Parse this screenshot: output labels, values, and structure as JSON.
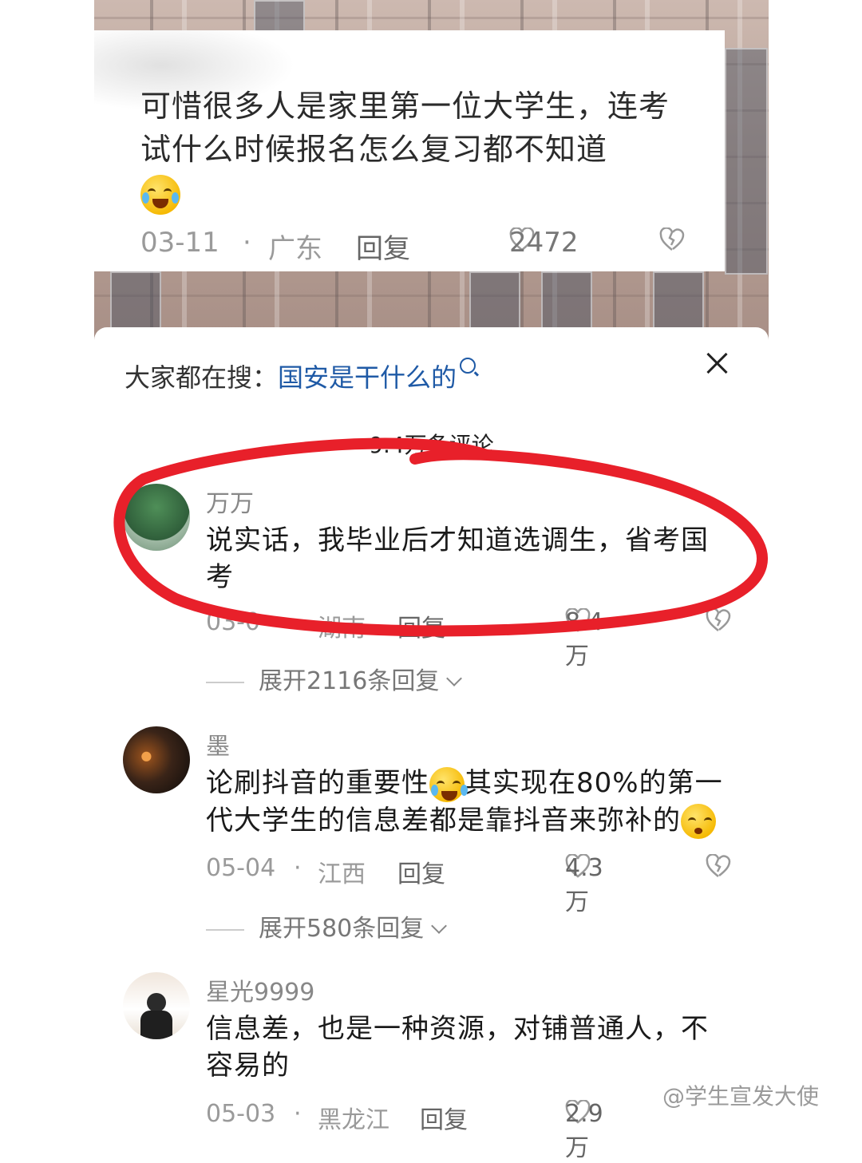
{
  "quote": {
    "text": "可惜很多人是家里第一位大学生，连考试什么时候报名怎么复习都不知道",
    "date": "03-11",
    "dot": "·",
    "location": "广东",
    "reply_label": "回复",
    "likes": "2472"
  },
  "search": {
    "prefix": "大家都在搜：",
    "query": "国安是干什么的"
  },
  "comment_count": "9.4万条评论",
  "comments": [
    {
      "user": "万万",
      "text": "说实话，我毕业后才知道选调生，省考国考",
      "date": "03-0",
      "dot": "·",
      "location": "湖南",
      "reply_label": "回复",
      "likes": "8.4万",
      "expand": "展开2116条回复"
    },
    {
      "user": "墨",
      "text_a": "论刷抖音的重要性",
      "text_b": "其实现在80%的第一代大学生的信息差都是靠抖音来弥补的",
      "date": "05-04",
      "dot": "·",
      "location": "江西",
      "reply_label": "回复",
      "likes": "4.3万",
      "expand": "展开580条回复"
    },
    {
      "user": "星光9999",
      "text": "信息差，也是一种资源，对铺普通人，不容易的",
      "date": "05-03",
      "dot": "·",
      "location": "黑龙江",
      "reply_label": "回复",
      "likes": "2.9万"
    }
  ],
  "watermark": "@学生宣发大使",
  "colors": {
    "link": "#1f5aa6",
    "mark": "#e8202a"
  }
}
